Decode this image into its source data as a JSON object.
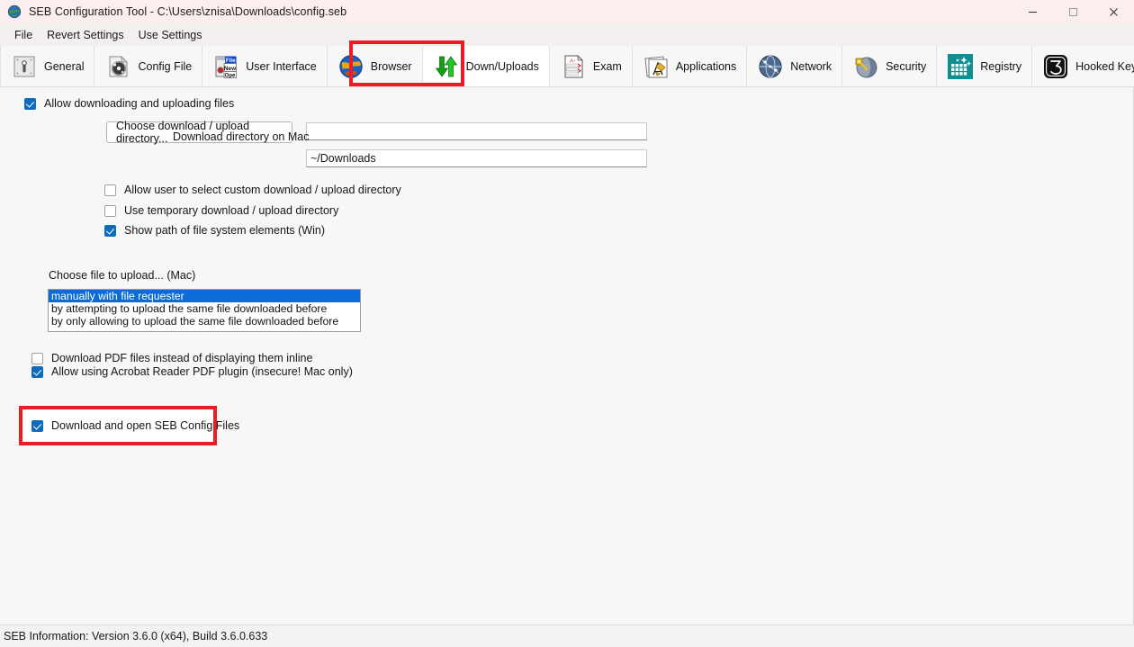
{
  "window": {
    "title": "SEB Configuration Tool - C:\\Users\\znisa\\Downloads\\config.seb",
    "app_icon": "seb-globe-icon",
    "controls": {
      "minimize": "minimize-icon",
      "maximize": "maximize-icon",
      "close": "close-icon"
    }
  },
  "menubar": {
    "items": [
      {
        "label": "File"
      },
      {
        "label": "Revert Settings"
      },
      {
        "label": "Use Settings"
      }
    ]
  },
  "toolbar": {
    "active_tab": "Down/Uploads",
    "highlight_color": "#ee1b24",
    "tabs": [
      {
        "label": "General",
        "icon": "lock-plate-icon"
      },
      {
        "label": "Config File",
        "icon": "config-disc-icon"
      },
      {
        "label": "User Interface",
        "icon": "file-new-window-icon"
      },
      {
        "label": "Browser",
        "icon": "globe-browser-icon"
      },
      {
        "label": "Down/Uploads",
        "icon": "down-up-arrows-icon"
      },
      {
        "label": "Exam",
        "icon": "exam-sheet-icon"
      },
      {
        "label": "Applications",
        "icon": "applications-icon"
      },
      {
        "label": "Network",
        "icon": "network-globe-icon"
      },
      {
        "label": "Security",
        "icon": "security-key-globe-icon"
      },
      {
        "label": "Registry",
        "icon": "registry-grid-icon"
      },
      {
        "label": "Hooked Keys",
        "icon": "hooked-keys-icon"
      }
    ]
  },
  "main": {
    "allow_downloading": {
      "label": "Allow downloading and uploading files",
      "checked": true
    },
    "choose_directory_button": {
      "label": "Choose download / upload directory..."
    },
    "directory_field": {
      "value": "",
      "placeholder": ""
    },
    "download_directory_mac": {
      "label": "Download directory on Mac",
      "value": "~/Downloads"
    },
    "options": [
      {
        "label": "Allow user to select custom download / upload directory",
        "checked": false
      },
      {
        "label": "Use temporary download / upload directory",
        "checked": false
      },
      {
        "label": "Show path of file system elements (Win)",
        "checked": true
      }
    ],
    "upload_section": {
      "label": "Choose file to upload... (Mac)",
      "selected_index": 0,
      "items": [
        "manually with file requester",
        "by attempting to upload the same file downloaded before",
        "by only allowing to upload the same file downloaded before"
      ]
    },
    "pdf_options": [
      {
        "label": "Download PDF files instead of displaying them inline",
        "checked": false
      },
      {
        "label": "Allow using Acrobat Reader PDF plugin (insecure! Mac only)",
        "checked": true
      }
    ],
    "seb_config": {
      "label": "Download and open SEB Config Files",
      "checked": true,
      "highlighted": true
    }
  },
  "statusbar": {
    "text": "SEB Information: Version 3.6.0 (x64), Build 3.6.0.633"
  }
}
